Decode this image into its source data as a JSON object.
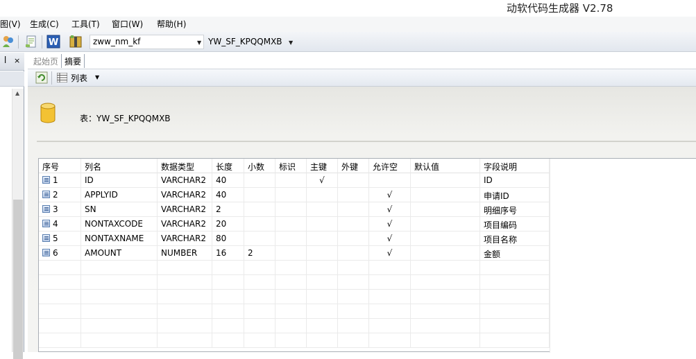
{
  "app": {
    "title": "动软代码生成器  V2.78"
  },
  "menu": {
    "items": [
      {
        "label": "图(V)"
      },
      {
        "label": "生成(C)"
      },
      {
        "label": "工具(T)"
      },
      {
        "label": "窗口(W)"
      },
      {
        "label": "帮助(H)"
      }
    ]
  },
  "toolbar": {
    "database_select": "zww_nm_kf",
    "table_select": "YW_SF_KPQQMXB"
  },
  "left_panel": {
    "pin": "ꟾ",
    "close": "×"
  },
  "tabs": [
    {
      "label": "起始页"
    },
    {
      "label": "摘要"
    }
  ],
  "subtoolbar": {
    "view_label": "列表"
  },
  "summary": {
    "table_label": "表：YW_SF_KPQQMXB"
  },
  "grid": {
    "columns": [
      "序号",
      "列名",
      "数据类型",
      "长度",
      "小数",
      "标识",
      "主键",
      "外键",
      "允许空",
      "默认值",
      "字段说明"
    ],
    "rows": [
      {
        "no": "1",
        "name": "ID",
        "type": "VARCHAR2",
        "length": "40",
        "scale": "",
        "identity": "",
        "pk": "√",
        "fk": "",
        "nullable": "",
        "default": "",
        "desc": "ID"
      },
      {
        "no": "2",
        "name": "APPLYID",
        "type": "VARCHAR2",
        "length": "40",
        "scale": "",
        "identity": "",
        "pk": "",
        "fk": "",
        "nullable": "√",
        "default": "",
        "desc": "申请ID"
      },
      {
        "no": "3",
        "name": "SN",
        "type": "VARCHAR2",
        "length": "2",
        "scale": "",
        "identity": "",
        "pk": "",
        "fk": "",
        "nullable": "√",
        "default": "",
        "desc": "明细序号"
      },
      {
        "no": "4",
        "name": "NONTAXCODE",
        "type": "VARCHAR2",
        "length": "20",
        "scale": "",
        "identity": "",
        "pk": "",
        "fk": "",
        "nullable": "√",
        "default": "",
        "desc": "项目编码"
      },
      {
        "no": "5",
        "name": "NONTAXNAME",
        "type": "VARCHAR2",
        "length": "80",
        "scale": "",
        "identity": "",
        "pk": "",
        "fk": "",
        "nullable": "√",
        "default": "",
        "desc": "项目名称"
      },
      {
        "no": "6",
        "name": "AMOUNT",
        "type": "NUMBER",
        "length": "16",
        "scale": "2",
        "identity": "",
        "pk": "",
        "fk": "",
        "nullable": "√",
        "default": "",
        "desc": "金额"
      }
    ]
  }
}
